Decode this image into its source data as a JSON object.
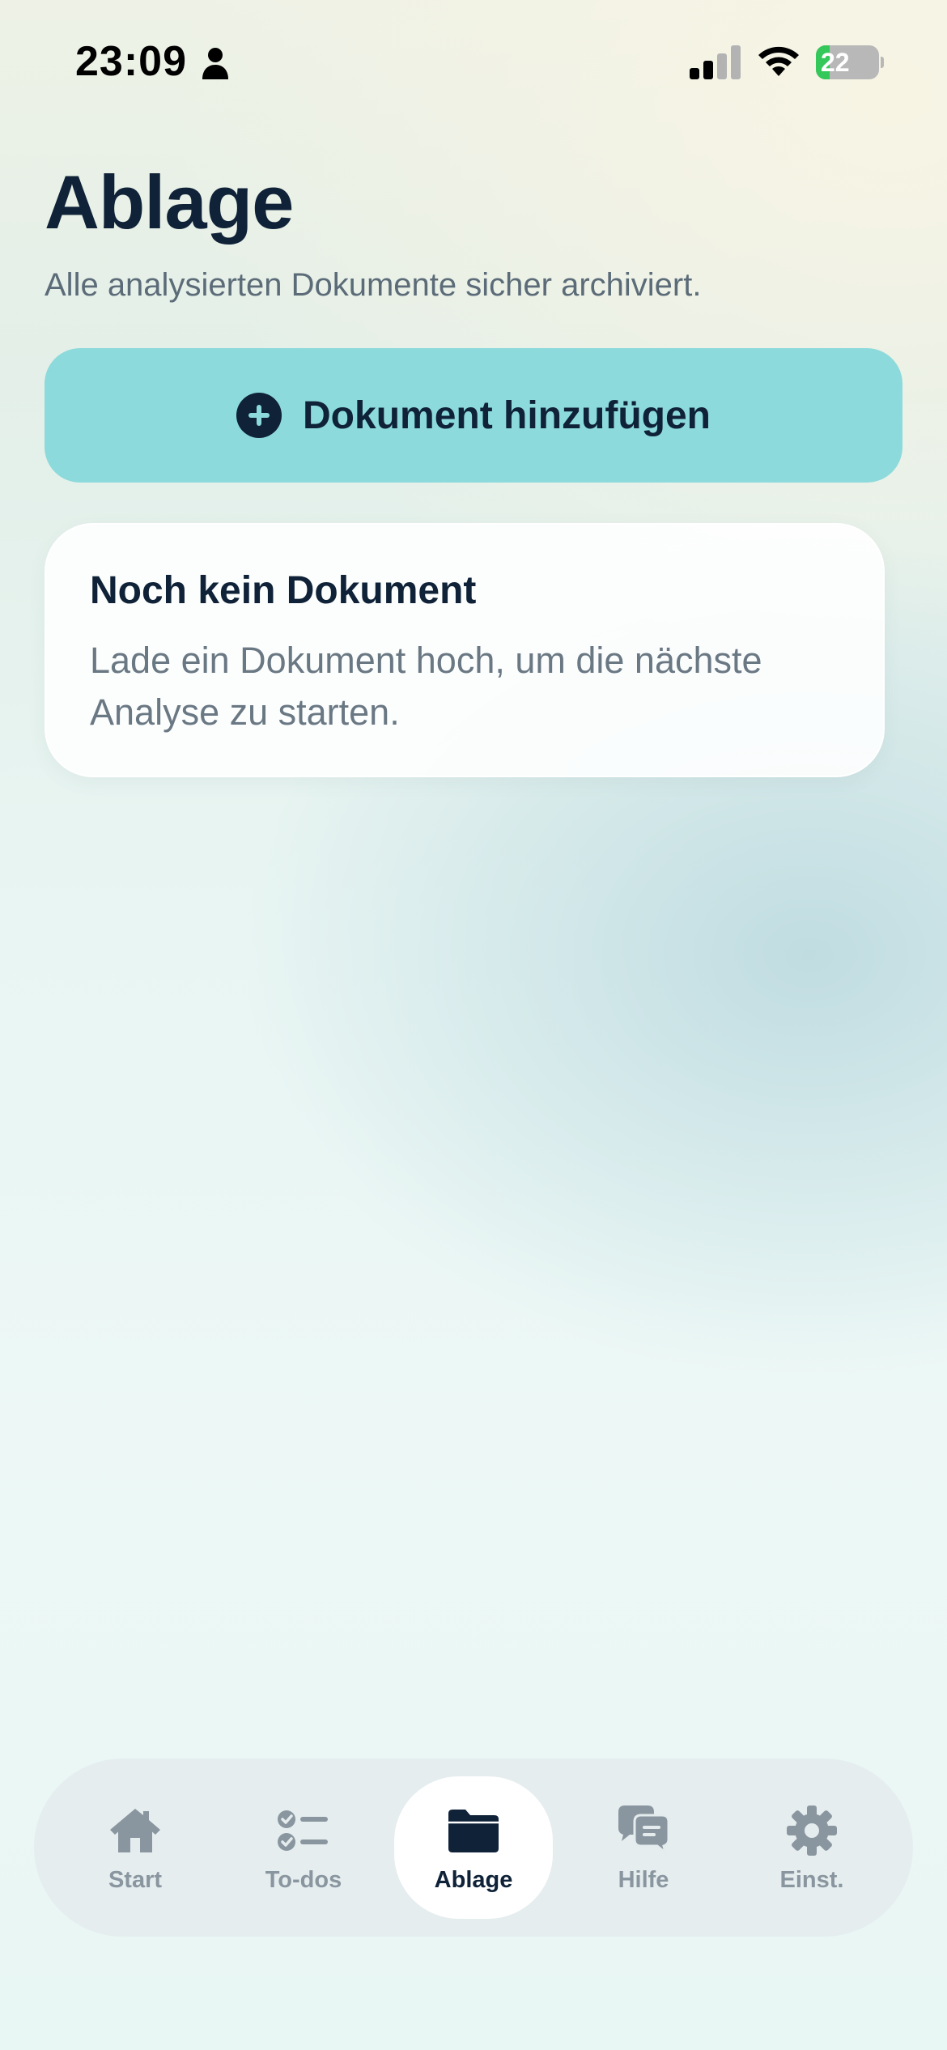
{
  "status_bar": {
    "time": "23:09",
    "battery_level": "22",
    "battery_fraction": 0.22
  },
  "header": {
    "title": "Ablage",
    "subtitle": "Alle analysierten Dokumente sicher archiviert."
  },
  "add_button": {
    "label": "Dokument hinzufügen",
    "icon": "plus-circle-icon"
  },
  "empty_state": {
    "title": "Noch kein Dokument",
    "text": "Lade ein Dokument hoch, um die nächste Analyse zu starten."
  },
  "tab_bar": {
    "active": "Ablage",
    "items": [
      {
        "label": "Start",
        "icon": "home-icon"
      },
      {
        "label": "To-dos",
        "icon": "checklist-icon"
      },
      {
        "label": "Ablage",
        "icon": "folder-icon"
      },
      {
        "label": "Hilfe",
        "icon": "chat-bubbles-icon"
      },
      {
        "label": "Einst.",
        "icon": "gear-icon"
      }
    ]
  },
  "colors": {
    "accent": "#8cdadb",
    "text_primary": "#0f2238",
    "text_secondary": "#5b6b78",
    "tab_inactive": "#8a969f",
    "battery_green": "#34c759"
  }
}
